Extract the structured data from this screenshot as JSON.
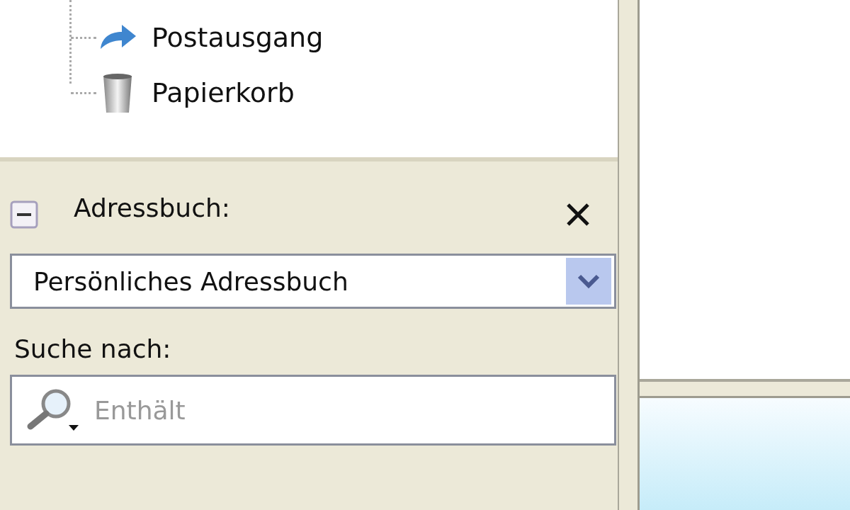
{
  "folders": [
    {
      "name": "Postausgang",
      "kind": "outbox"
    },
    {
      "name": "Papierkorb",
      "kind": "trash"
    }
  ],
  "address_book": {
    "title": "Adressbuch:",
    "expanded": true,
    "selected_book": "Persönliches Adressbuch",
    "search_label": "Suche nach:",
    "search": {
      "placeholder": "Enthält"
    }
  }
}
